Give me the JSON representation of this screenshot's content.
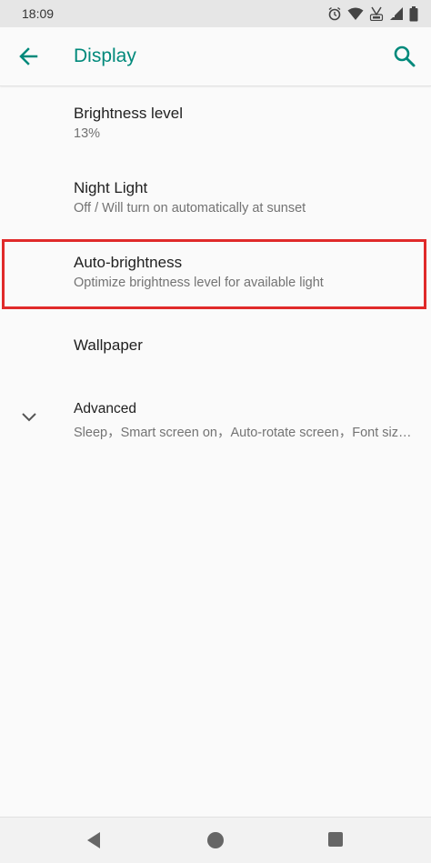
{
  "status_bar": {
    "time": "18:09",
    "icons": [
      "alarm-icon",
      "wifi-icon",
      "volte-icon",
      "signal-icon",
      "battery-icon"
    ]
  },
  "app_bar": {
    "title": "Display",
    "back_icon": "back-arrow-icon",
    "search_icon": "search-icon",
    "accent_color": "#00897b"
  },
  "settings": {
    "items": [
      {
        "title": "Brightness level",
        "summary": "13%"
      },
      {
        "title": "Night Light",
        "summary": "Off / Will turn on automatically at sunset"
      },
      {
        "title": "Auto-brightness",
        "summary": "Optimize brightness level for available light"
      },
      {
        "title": "Wallpaper"
      },
      {
        "title": "Advanced",
        "summary": "Sleep，Smart screen on，Auto-rotate screen，Font size，Display size"
      }
    ],
    "highlight_color": "#e02a2a"
  },
  "nav_bar": {
    "buttons": [
      "nav-back-icon",
      "nav-home-icon",
      "nav-recents-icon"
    ]
  }
}
